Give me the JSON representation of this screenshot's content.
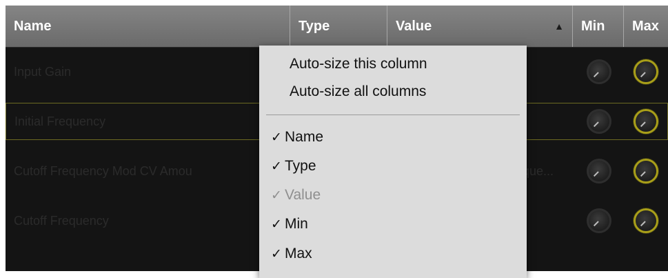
{
  "columns": {
    "name": "Name",
    "type": "Type",
    "value": "Value",
    "min": "Min",
    "max": "Max",
    "sort_indicator": "▲"
  },
  "rows": [
    {
      "name": "Input Gain",
      "value": "",
      "selected": false
    },
    {
      "name": "Initial Frequency",
      "value": "",
      "selected": true
    },
    {
      "name": "Cutoff Frequency Mod CV Amou",
      "value": "eque...",
      "selected": false
    },
    {
      "name": "Cutoff Frequency",
      "value": "",
      "selected": false
    }
  ],
  "context_menu": {
    "autosize_this": "Auto-size this column",
    "autosize_all": "Auto-size all columns",
    "columns": [
      {
        "label": "Name",
        "checked": true,
        "enabled": true
      },
      {
        "label": "Type",
        "checked": true,
        "enabled": true
      },
      {
        "label": "Value",
        "checked": true,
        "enabled": false
      },
      {
        "label": "Min",
        "checked": true,
        "enabled": true
      },
      {
        "label": "Max",
        "checked": true,
        "enabled": true
      }
    ],
    "check_glyph": "✓"
  },
  "colors": {
    "background": "#141414",
    "header": "#777777",
    "knob_accent": "#a99f19",
    "menu_background": "#dcdcdc"
  },
  "icons": [
    "sort-ascending-icon",
    "knob-icon",
    "checkmark-icon"
  ]
}
